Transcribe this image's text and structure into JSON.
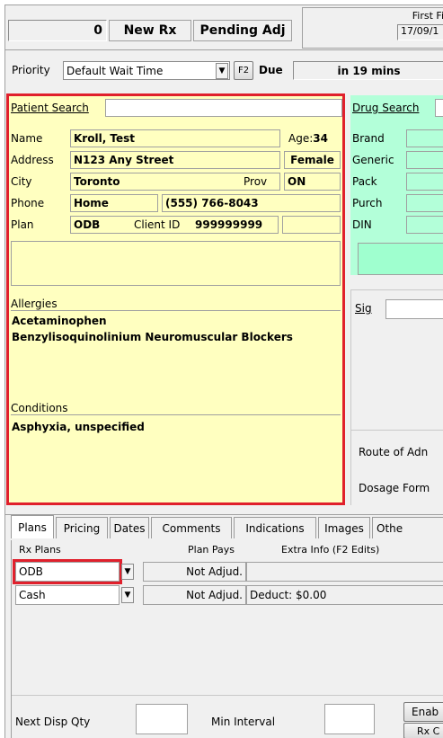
{
  "header": {
    "count": "0",
    "new_rx": "New Rx",
    "pending": "Pending Adj",
    "first_fill_label": "First Fi",
    "first_fill_date": "17/09/1"
  },
  "priority": {
    "label": "Priority",
    "value": "Default Wait Time",
    "f2": "F2",
    "due_label": "Due",
    "due_value": "in 19 mins"
  },
  "patient": {
    "search_label": "Patient Search",
    "name_label": "Name",
    "name": "Kroll, Test",
    "age_label": "Age",
    "age": "34",
    "address_label": "Address",
    "address": "N123 Any Street",
    "gender": "Female",
    "city_label": "City",
    "city": "Toronto",
    "prov_label": "Prov",
    "prov": "ON",
    "phone_label": "Phone",
    "phone_type": "Home",
    "phone": "(555) 766-8043",
    "plan_label": "Plan",
    "plan": "ODB",
    "client_id_label": "Client ID",
    "client_id": "999999999",
    "allergies_label": "Allergies",
    "allergies": [
      "Acetaminophen",
      "Benzylisoquinolinium Neuromuscular Blockers"
    ],
    "conditions_label": "Conditions",
    "conditions": [
      "Asphyxia, unspecified"
    ]
  },
  "drug": {
    "search_label": "Drug Search",
    "brand": "Brand",
    "generic": "Generic",
    "pack": "Pack",
    "purch": "Purch",
    "din": "DIN",
    "sig": "Sig",
    "route": "Route of Adn",
    "dosage": "Dosage Form"
  },
  "tabs": [
    "Plans",
    "Pricing",
    "Dates",
    "Comments",
    "Indications",
    "Images",
    "Othe"
  ],
  "plans_table": {
    "col1": "Rx Plans",
    "col2": "Plan Pays",
    "col3": "Extra Info (F2 Edits)",
    "rows": [
      {
        "plan": "ODB",
        "pays": "Not Adjud.",
        "info": ""
      },
      {
        "plan": "Cash",
        "pays": "Not Adjud.",
        "info": "Deduct: $0.00"
      }
    ]
  },
  "footer": {
    "next_disp": "Next Disp Qty",
    "min_interval": "Min Interval",
    "enable_btn": "Enab",
    "rxc_btn": "Rx C"
  },
  "colors": {
    "highlight": "#e0202c",
    "patient_bg": "#ffffc0",
    "drug_bg": "#b3ffd9"
  }
}
